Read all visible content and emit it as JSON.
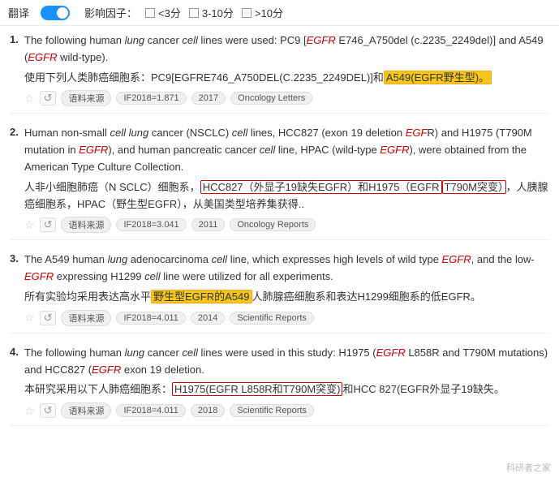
{
  "topbar": {
    "translate_label": "翻译",
    "impact_label": "影响因子：",
    "filter1_label": "<3分",
    "filter2_label": "3-10分",
    "filter3_label": ">10分"
  },
  "results": [
    {
      "number": "1.",
      "en_parts": [
        {
          "text": "The following human ",
          "style": "normal"
        },
        {
          "text": "lung",
          "style": "italic"
        },
        {
          "text": " cancer ",
          "style": "normal"
        },
        {
          "text": "cell",
          "style": "italic"
        },
        {
          "text": " lines were used: PC9 [",
          "style": "normal"
        },
        {
          "text": "EGFR",
          "style": "egfr"
        },
        {
          "text": " E746_A750del (c.2235_2249del)] and A549 (",
          "style": "normal"
        },
        {
          "text": "EGFR",
          "style": "egfr"
        },
        {
          "text": " wild-type).",
          "style": "normal"
        }
      ],
      "zh_before": "使用下列人类肺癌细胞系：PC9[EGFRE746_A750DEL(C.2235_2249DEL)]和",
      "zh_highlight": "A549(EGFR野生型)。",
      "zh_after": "",
      "highlight_color": "yellow",
      "meta": {
        "if": "IF2018=1.871",
        "year": "2017",
        "journal": "Oncology Letters"
      }
    },
    {
      "number": "2.",
      "en_parts": [
        {
          "text": "Human non-small ",
          "style": "normal"
        },
        {
          "text": "cell lung",
          "style": "italic"
        },
        {
          "text": " cancer (NSCLC) ",
          "style": "normal"
        },
        {
          "text": "cell",
          "style": "italic"
        },
        {
          "text": " lines, HCC827 (exon 19 deletion ",
          "style": "normal"
        },
        {
          "text": "EGF",
          "style": "egfr"
        },
        {
          "text": "R) and H1975 (T790M mutation in ",
          "style": "normal"
        },
        {
          "text": "EGFR",
          "style": "egfr"
        },
        {
          "text": "), and human pancreatic cancer ",
          "style": "normal"
        },
        {
          "text": "cell",
          "style": "italic"
        },
        {
          "text": " line, HPAC (wild-type ",
          "style": "normal"
        },
        {
          "text": "EGFR",
          "style": "egfr"
        },
        {
          "text": "), were obtained from the American Type Culture Collection.",
          "style": "normal"
        }
      ],
      "zh_before": "人非小细胞肺癌（N SCLC）细胞系，",
      "zh_highlight": "HCC827（外显子19缺失EGFR）和H1975（EGFR",
      "zh_highlight2": "T790M突变）",
      "zh_after": "，人胰腺癌细胞系，HPAC（野生型EGFR），从美国类型培养集获得..",
      "highlight_color": "red",
      "meta": {
        "if": "IF2018=3.041",
        "year": "2011",
        "journal": "Oncology Reports"
      }
    },
    {
      "number": "3.",
      "en_parts": [
        {
          "text": "The A549 human ",
          "style": "normal"
        },
        {
          "text": "lung",
          "style": "italic"
        },
        {
          "text": " adenocarcinoma ",
          "style": "normal"
        },
        {
          "text": "cell",
          "style": "italic"
        },
        {
          "text": " line, which expresses high levels of wild type ",
          "style": "normal"
        },
        {
          "text": "EGFR",
          "style": "egfr"
        },
        {
          "text": ", and the low-",
          "style": "normal"
        },
        {
          "text": "EGFR",
          "style": "egfr"
        },
        {
          "text": " expressing H1299 ",
          "style": "normal"
        },
        {
          "text": "cell",
          "style": "italic"
        },
        {
          "text": " line were utilized for all experiments.",
          "style": "normal"
        }
      ],
      "zh_before": "所有实验均采用表达高水平",
      "zh_highlight": "野生型EGFR的A549",
      "zh_after": "人肺腺癌细胞系和表达H1299细胞系的低EGFR。",
      "highlight_color": "yellow",
      "meta": {
        "if": "IF2018=4.011",
        "year": "2014",
        "journal": "Scientific Reports"
      }
    },
    {
      "number": "4.",
      "en_parts": [
        {
          "text": "The following human ",
          "style": "normal"
        },
        {
          "text": "lung",
          "style": "italic"
        },
        {
          "text": " cancer ",
          "style": "normal"
        },
        {
          "text": "cell",
          "style": "italic"
        },
        {
          "text": " lines were used in this study: H1975 (",
          "style": "normal"
        },
        {
          "text": "EGFR",
          "style": "egfr"
        },
        {
          "text": " L858R and T790M mutations) and HCC827 (",
          "style": "normal"
        },
        {
          "text": "EGFR",
          "style": "egfr"
        },
        {
          "text": " exon 19 deletion.",
          "style": "normal"
        }
      ],
      "zh_before": "本研究采用以下人肺癌细胞系：",
      "zh_highlight": "H1975(EGFR L858R和T790M突变)",
      "zh_after": "和HCC 827(EGFR外显子19缺失。",
      "highlight_color": "red",
      "meta": {
        "if": "IF2018=4.011",
        "year": "2018",
        "journal": "Scientific Reports"
      }
    }
  ],
  "watermark": "科研者之家"
}
